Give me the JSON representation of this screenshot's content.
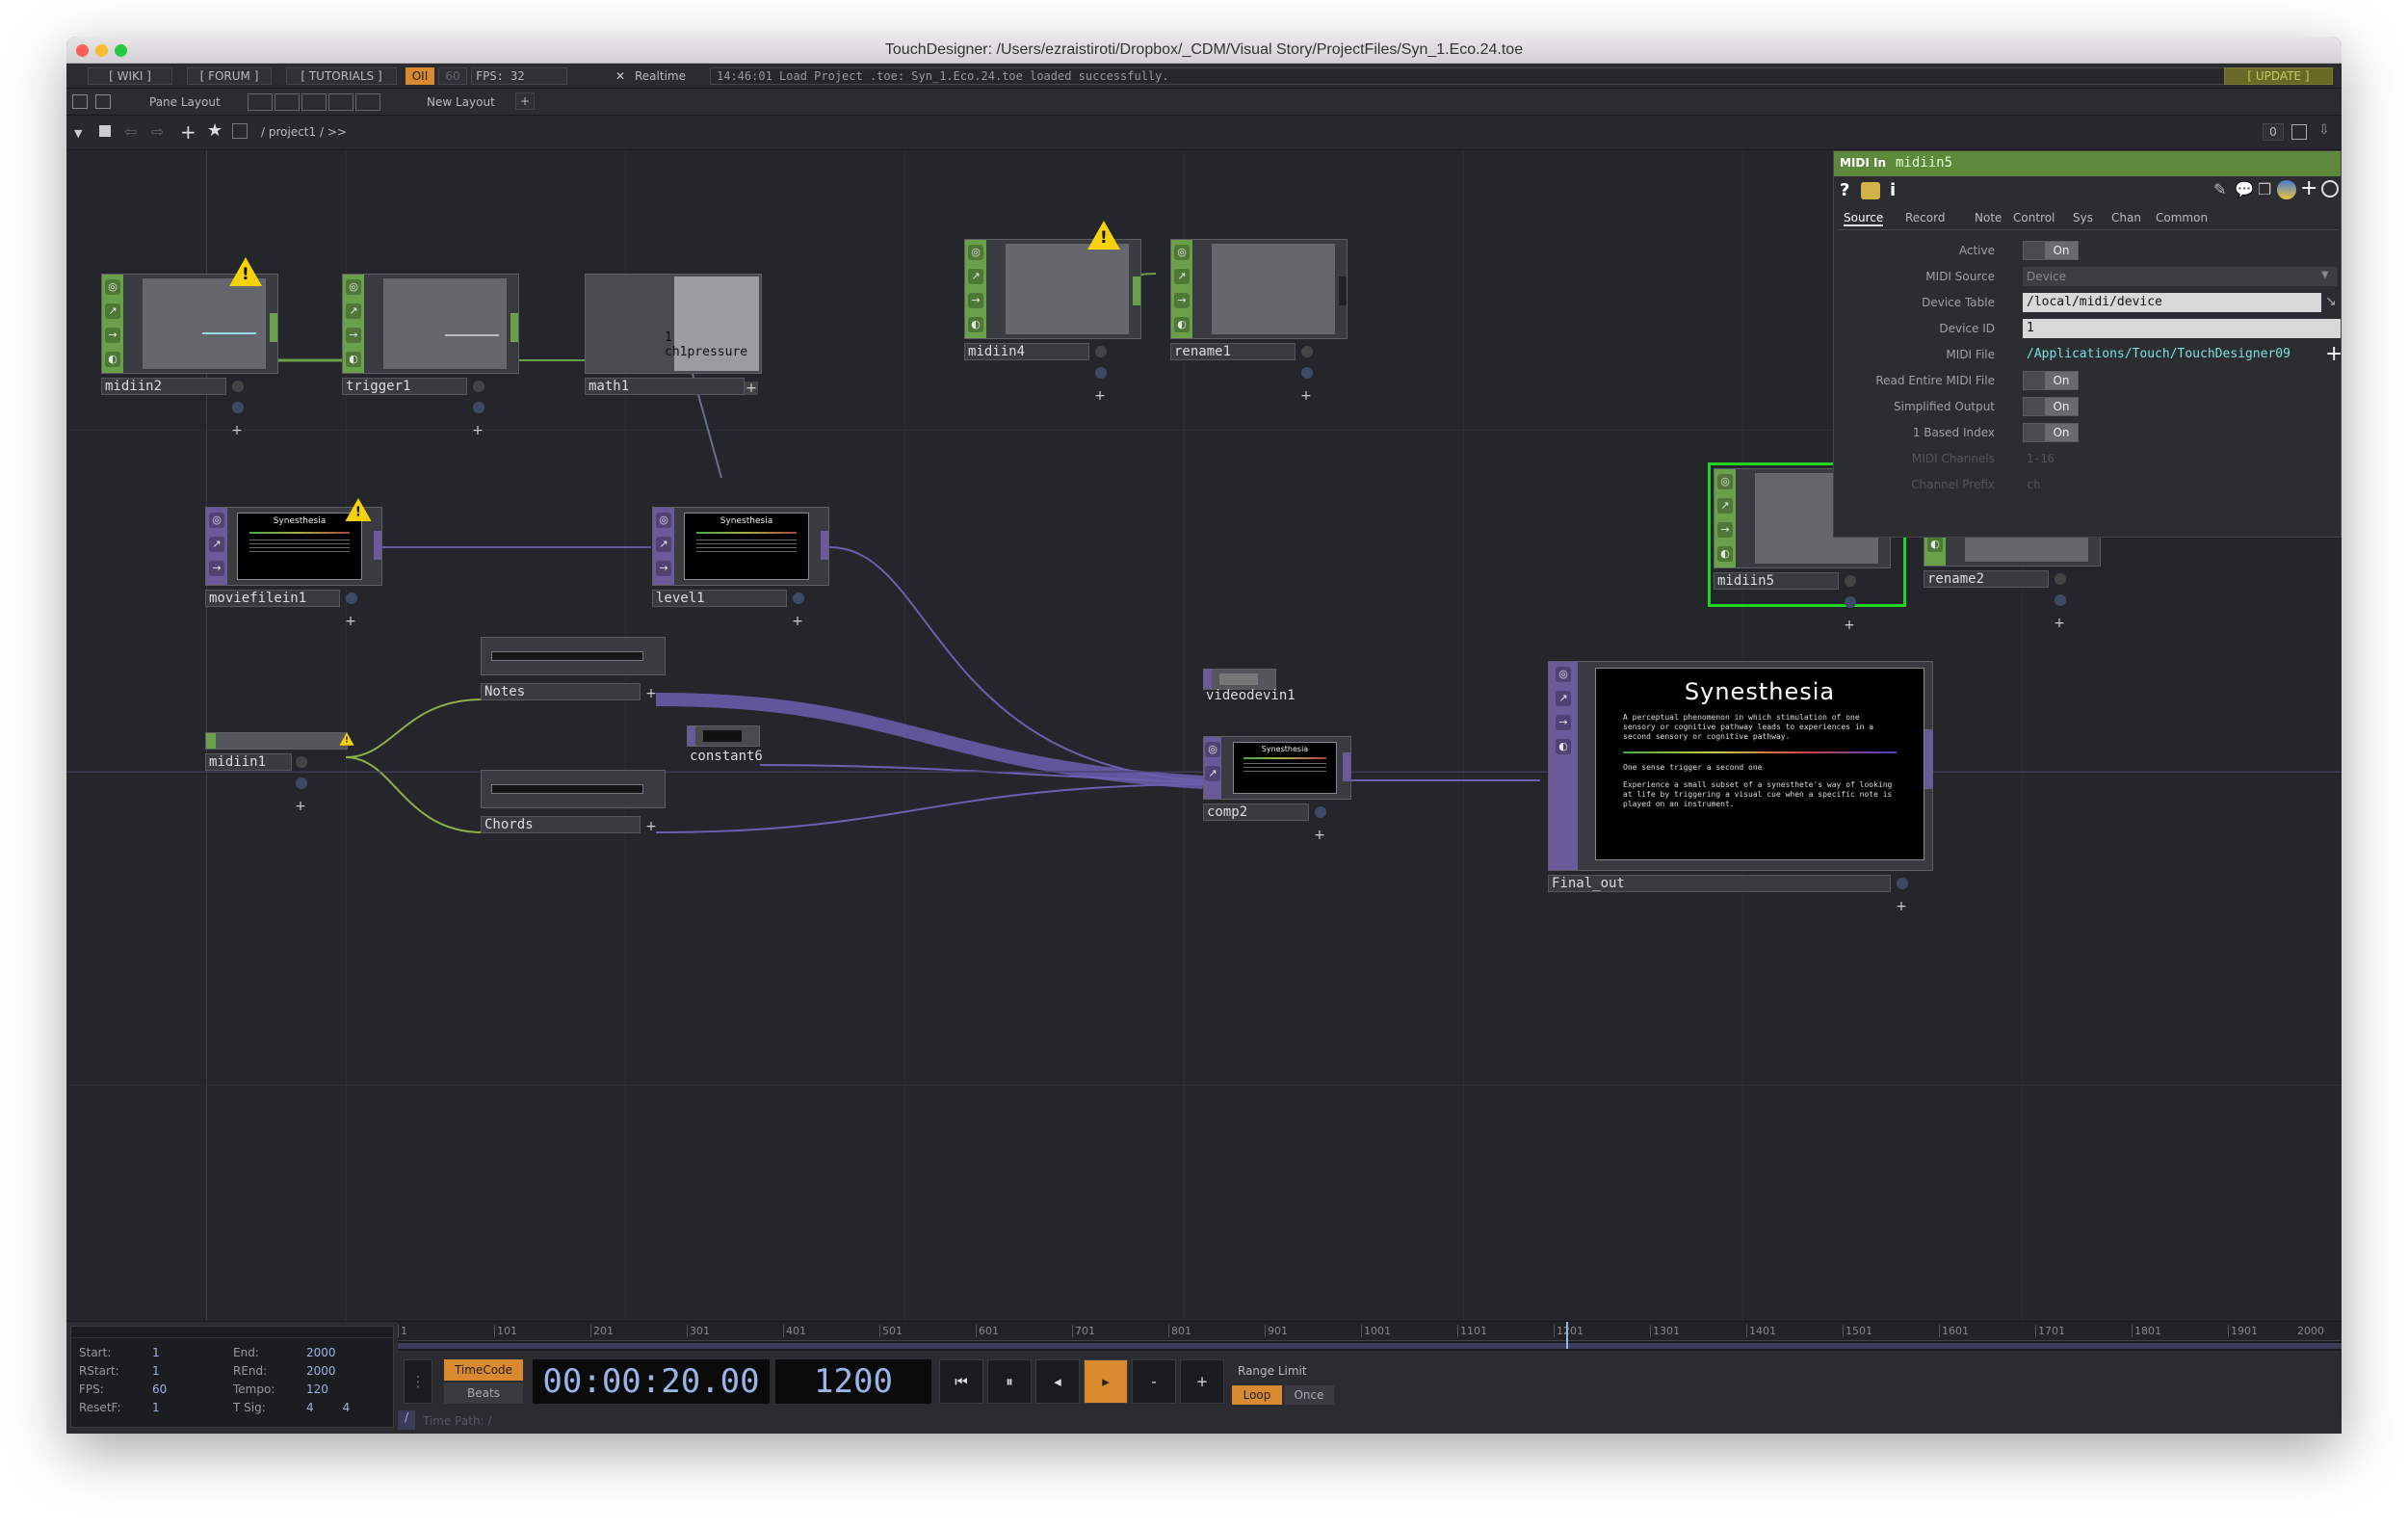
{
  "window": {
    "title": "TouchDesigner: /Users/ezraistiroti/Dropbox/_CDM/Visual Story/ProjectFiles/Syn_1.Eco.24.toe"
  },
  "menubar": {
    "wiki": "[ WIKI ]",
    "forum": "[ FORUM ]",
    "tutorials": "[ TUTORIALS ]",
    "oi": "OII",
    "sixty": "60",
    "fps": "FPS:  32",
    "realtime_check": "✕",
    "realtime": "Realtime",
    "status": "14:46:01 Load Project .toe: Syn_1.Eco.24.toe loaded successfully.",
    "update": "[ UPDATE ]"
  },
  "layoutbar": {
    "pane_layout": "Pane Layout",
    "new_layout": "New Layout",
    "plus": "+"
  },
  "pathbar": {
    "path": "/ project1 / >>",
    "zero": "0"
  },
  "nodes": {
    "midiin2": "midiin2",
    "trigger1": "trigger1",
    "math1": "math1",
    "math1_label": "1 ch1pressure",
    "midiin4": "midiin4",
    "rename1": "rename1",
    "moviefilein1": "moviefilein1",
    "level1": "level1",
    "notes": "Notes",
    "chords": "Chords",
    "midiin1": "midiin1",
    "constant6": "constant6",
    "videodevin1": "videodevin1",
    "comp2": "comp2",
    "midiin5": "midiin5",
    "rename2": "rename2",
    "final_out": "Final_out",
    "small_screen_title": "Synesthesia"
  },
  "final_screen": {
    "title": "Synesthesia",
    "para1": "A perceptual phenomenon in which stimulation of one sensory or cognitive pathway leads to experiences in a second sensory or cognitive pathway.",
    "para2": "One sense trigger a second one",
    "para3": "Experience a small subset of a synesthete's way of looking at life by triggering a visual cue when a specific note is played on an instrument."
  },
  "param_panel": {
    "type": "MIDI In",
    "name": "midiin5",
    "tabs": [
      "Source",
      "Record",
      "Note",
      "Control",
      "Sys",
      "Chan",
      "Common"
    ],
    "active_label": "Active",
    "active_value": "On",
    "midi_source_label": "MIDI Source",
    "midi_source_value": "Device",
    "device_table_label": "Device Table",
    "device_table_value": "/local/midi/device",
    "device_id_label": "Device ID",
    "device_id_value": "1",
    "midi_file_label": "MIDI File",
    "midi_file_value": "/Applications/Touch/TouchDesigner09",
    "read_entire_label": "Read Entire MIDI File",
    "read_entire_value": "On",
    "simplified_label": "Simplified Output",
    "simplified_value": "On",
    "one_based_label": "1 Based Index",
    "one_based_value": "On",
    "midi_channels_label": "MIDI Channels",
    "midi_channels_value": "1-16",
    "channel_prefix_label": "Channel Prefix",
    "channel_prefix_value": "ch"
  },
  "timeline": {
    "ticks": [
      "1",
      "101",
      "201",
      "301",
      "401",
      "501",
      "601",
      "701",
      "801",
      "901",
      "1001",
      "1101",
      "1201",
      "1301",
      "1401",
      "1501",
      "1601",
      "1701",
      "1801",
      "1901",
      "2000"
    ],
    "start_label": "Start:",
    "start": "1",
    "end_label": "End:",
    "end": "2000",
    "rstart_label": "RStart:",
    "rstart": "1",
    "rend_label": "REnd:",
    "rend": "2000",
    "fps_label": "FPS:",
    "fps": "60",
    "tempo_label": "Tempo:",
    "tempo": "120",
    "resetf_label": "ResetF:",
    "resetf": "1",
    "tsig_label": "T Sig:",
    "tsig_a": "4",
    "tsig_b": "4",
    "timecode": "TimeCode",
    "beats": "Beats",
    "time": "00:00:20.00",
    "frame": "1200",
    "range_limit": "Range Limit",
    "loop": "Loop",
    "once": "Once",
    "time_path": "Time Path: /",
    "minus": "-",
    "plus": "+"
  },
  "colors": {
    "chop_green": "#6aa04a",
    "top_purple": "#6a5a9a",
    "warning": "#f5d20c",
    "accent_orange": "#d98a2e",
    "selected_green": "#22d322"
  }
}
